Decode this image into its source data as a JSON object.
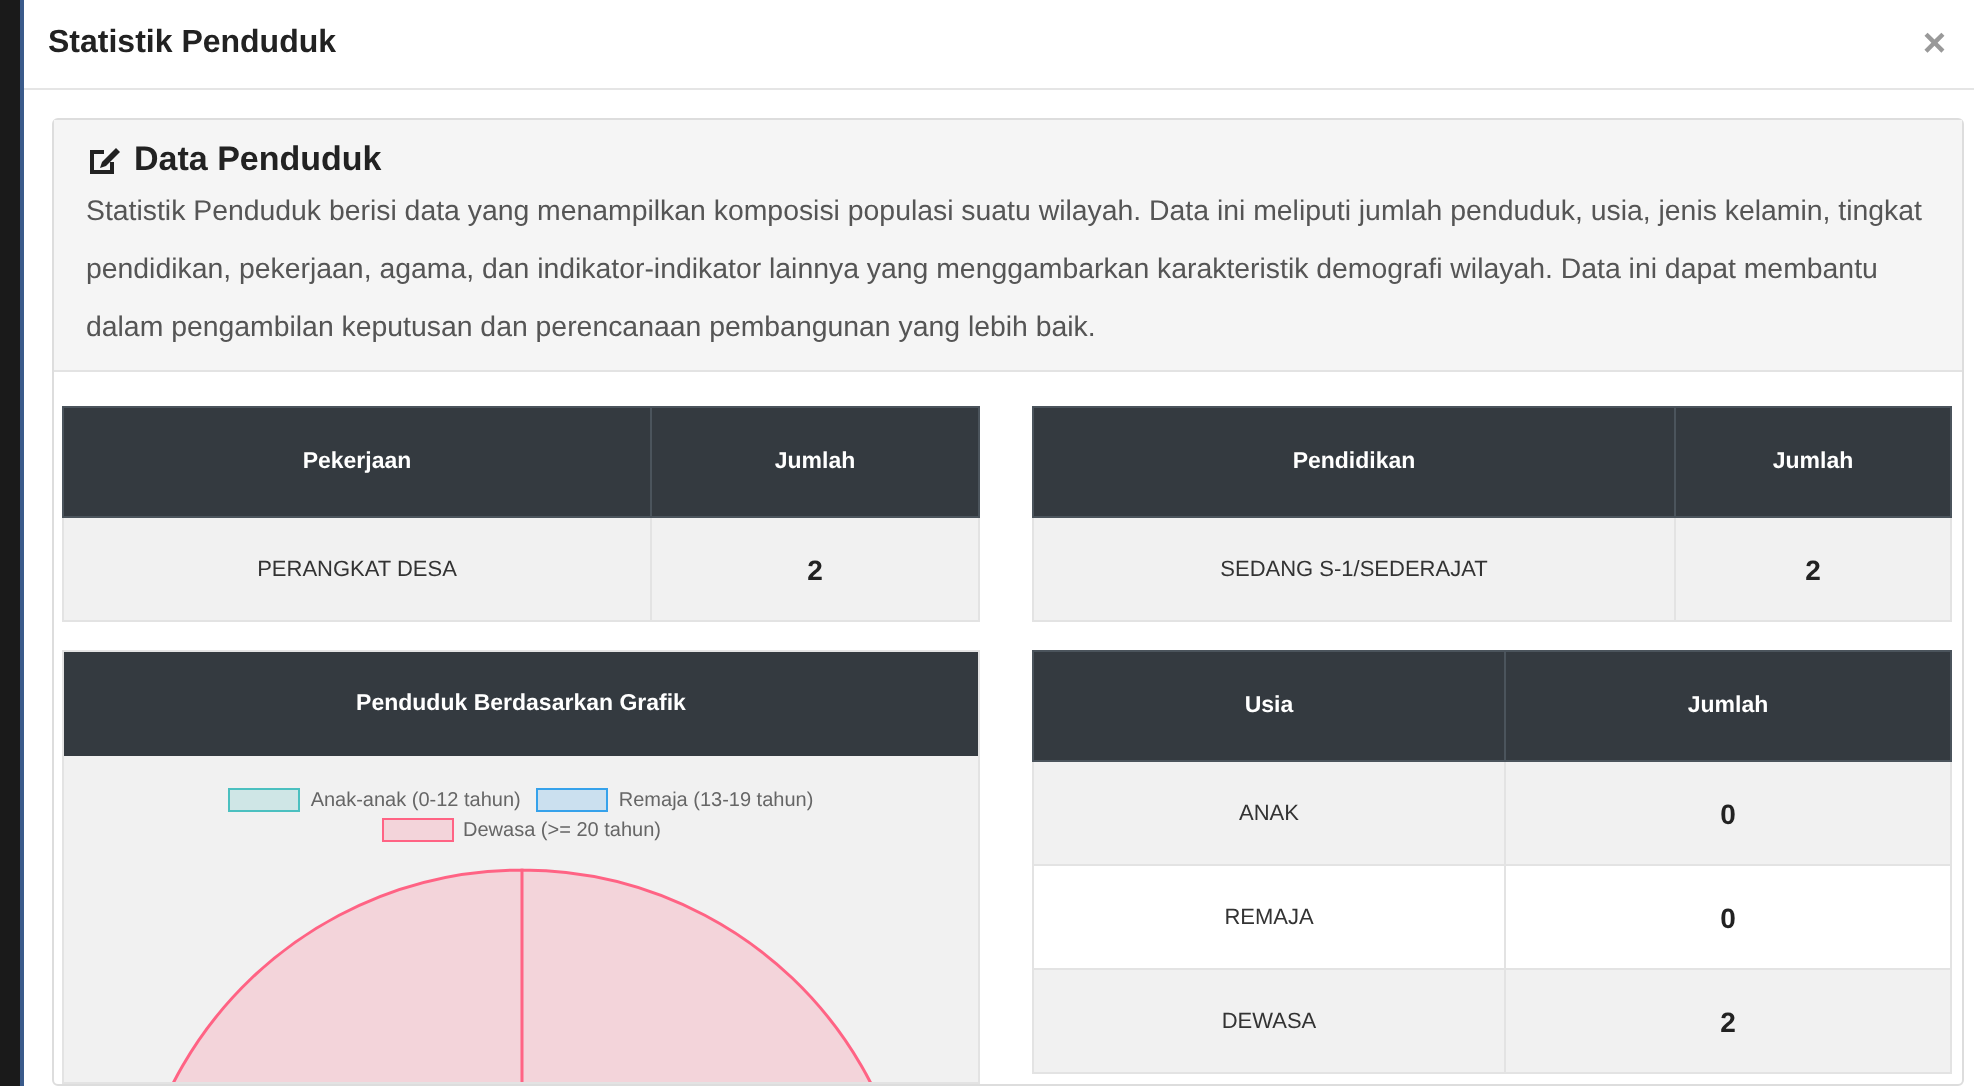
{
  "modal": {
    "title": "Statistik Penduduk",
    "close": "×"
  },
  "intro": {
    "title": "Data Penduduk",
    "text": "Statistik Penduduk berisi data yang menampilkan komposisi populasi suatu wilayah. Data ini meliputi jumlah penduduk, usia, jenis kelamin, tingkat pendidikan, pekerjaan, agama, dan indikator-indikator lainnya yang menggambarkan karakteristik demografi wilayah. Data ini dapat membantu dalam pengambilan keputusan dan perencanaan pembangunan yang lebih baik."
  },
  "pekerjaan_table": {
    "columns": [
      "Pekerjaan",
      "Jumlah"
    ],
    "rows": [
      [
        "PERANGKAT DESA",
        "2"
      ]
    ]
  },
  "pendidikan_table": {
    "columns": [
      "Pendidikan",
      "Jumlah"
    ],
    "rows": [
      [
        "SEDANG S-1/SEDERAJAT",
        "2"
      ]
    ]
  },
  "chart_panel": {
    "title": "Penduduk Berdasarkan Grafik",
    "chart_data": {
      "type": "pie",
      "categories": [
        "Anak-anak (0-12 tahun)",
        "Remaja (13-19 tahun)",
        "Dewasa (>= 20 tahun)"
      ],
      "values": [
        0,
        0,
        100
      ],
      "colors": [
        "#4bc0c0",
        "#36a2eb",
        "#ff6384"
      ]
    }
  },
  "usia_table": {
    "columns": [
      "Usia",
      "Jumlah"
    ],
    "rows": [
      [
        "ANAK",
        "0"
      ],
      [
        "REMAJA",
        "0"
      ],
      [
        "DEWASA",
        "2"
      ]
    ]
  }
}
